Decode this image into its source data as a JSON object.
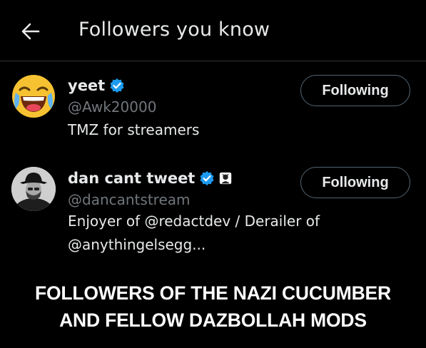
{
  "header": {
    "back_icon": "arrow-left-icon",
    "title": "Followers you know"
  },
  "followers": [
    {
      "name": "yeet",
      "verified": true,
      "avatar": "laughing-emoji-avatar",
      "handle": "@Awk20000",
      "bio_lines": [
        "TMZ for streamers"
      ],
      "button_label": "Following"
    },
    {
      "name": "dan cant tweet",
      "verified": true,
      "extra_badge": "affiliate-badge-icon",
      "avatar": "man-in-hat-photo-avatar",
      "handle": "@dancantstream",
      "bio_lines": [
        "Enjoyer of @redactdev / Derailer of",
        "@anythingelsegg..."
      ],
      "button_label": "Following"
    }
  ],
  "caption": {
    "line1": "FOLLOWERS OF THE NAZI CUCUMBER",
    "line2": "AND FELLOW DAZBOLLAH MODS"
  },
  "colors": {
    "background": "#000000",
    "text": "#e7e9ea",
    "secondary_text": "#71767b",
    "verified_blue": "#1d9bf0",
    "button_border": "#536471"
  }
}
